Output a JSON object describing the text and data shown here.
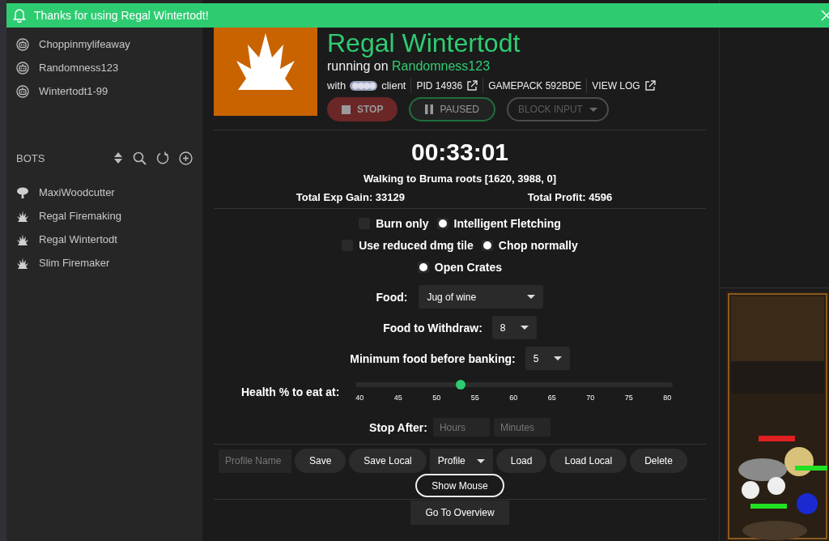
{
  "toast": {
    "message": "Thanks for using Regal Wintertodt!"
  },
  "accounts": [
    {
      "name": "Choppinmylifeaway"
    },
    {
      "name": "Randomness123"
    },
    {
      "name": "Wintertodt1-99"
    }
  ],
  "bots_header": {
    "title": "BOTS"
  },
  "bots": [
    {
      "name": "MaxiWoodcutter",
      "kind": "tree"
    },
    {
      "name": "Regal Firemaking",
      "kind": "flame"
    },
    {
      "name": "Regal Wintertodt",
      "kind": "flame"
    },
    {
      "name": "Slim Firemaker",
      "kind": "flame"
    }
  ],
  "script": {
    "title": "Regal Wintertodt",
    "running_on": "running on",
    "account": "Randomness123",
    "with": "with",
    "client": "client",
    "pid": "PID 14936",
    "gamepack": "GAMEPACK 592BDE",
    "view_log": "VIEW LOG"
  },
  "controls": [
    {
      "label": "STOP",
      "kind": "stop",
      "disabled": false
    },
    {
      "label": "PAUSED",
      "kind": "pause",
      "disabled": false
    },
    {
      "label": "BLOCK INPUT",
      "kind": "dropdown",
      "disabled": true
    }
  ],
  "timer": "00:33:01",
  "status": "Walking to Bruma roots [1620, 3988, 0]",
  "stats": [
    "Total Exp Gain: 33129",
    "Total Profit: 4596"
  ],
  "options": [
    [
      {
        "label": "Burn only",
        "kind": "checkbox",
        "checked": false
      },
      {
        "label": "Intelligent Fletching",
        "kind": "radio",
        "checked": true
      }
    ],
    [
      {
        "label": "Use reduced dmg tile",
        "kind": "checkbox",
        "checked": false
      },
      {
        "label": "Chop normally",
        "kind": "radio",
        "checked": true
      }
    ],
    [
      {
        "label": "Open Crates",
        "kind": "radio",
        "checked": true
      }
    ]
  ],
  "selects": [
    {
      "label": "Food:",
      "value": "Jug of wine"
    },
    {
      "label": "Food to Withdraw:",
      "value": "8"
    },
    {
      "label": "Minimum food before banking:",
      "value": "5"
    }
  ],
  "health": {
    "label": "Health % to eat at:",
    "level": 0.33,
    "ticks": [
      "40",
      "45",
      "50",
      "55",
      "60",
      "65",
      "70",
      "75",
      "80"
    ]
  },
  "stop_after": {
    "label": "Stop After:",
    "hours_placeholder": "Hours",
    "minutes_placeholder": "Minutes"
  },
  "profile_bar": [
    {
      "kind": "input",
      "placeholder": "Profile Name"
    },
    {
      "kind": "button",
      "label": "Save"
    },
    {
      "kind": "button",
      "label": "Save Local"
    },
    {
      "kind": "select",
      "label": "Profile"
    },
    {
      "kind": "button",
      "label": "Load"
    },
    {
      "kind": "button",
      "label": "Load Local"
    },
    {
      "kind": "button",
      "label": "Delete"
    }
  ],
  "show_mouse": "Show Mouse",
  "overview": "Go To Overview",
  "ad": {
    "kind": "picture"
  }
}
